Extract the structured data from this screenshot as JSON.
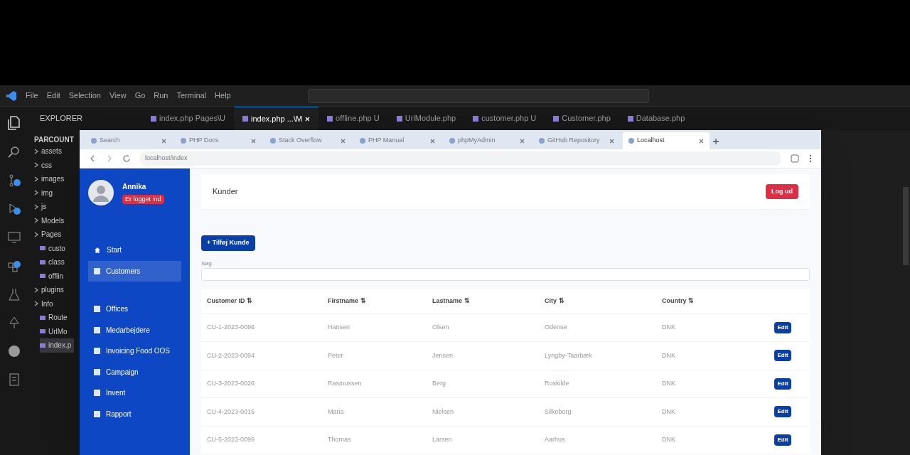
{
  "editor": {
    "menu": [
      "File",
      "Edit",
      "Selection",
      "View",
      "Go",
      "Run",
      "Terminal",
      "Help"
    ],
    "tabs": [
      {
        "label": "index.php Pages\\U",
        "selected": false
      },
      {
        "label": "index.php ...\\M",
        "selected": true
      },
      {
        "label": "offline.php U",
        "selected": false
      },
      {
        "label": "UrlModule.php",
        "selected": false
      },
      {
        "label": "customer.php U",
        "selected": false
      },
      {
        "label": "Customer.php",
        "selected": false
      },
      {
        "label": "Database.php",
        "selected": false
      }
    ],
    "explorer": {
      "title": "EXPLORER",
      "root": "PARCOUNT",
      "items": [
        {
          "label": "assets",
          "kind": "folder"
        },
        {
          "label": "css",
          "kind": "folder"
        },
        {
          "label": "images",
          "kind": "folder"
        },
        {
          "label": "img",
          "kind": "folder"
        },
        {
          "label": "js",
          "kind": "folder"
        },
        {
          "label": "Models",
          "kind": "folder"
        },
        {
          "label": "Pages",
          "kind": "folder"
        },
        {
          "label": "custo",
          "kind": "file"
        },
        {
          "label": "class",
          "kind": "file"
        },
        {
          "label": "offlin",
          "kind": "file"
        },
        {
          "label": "plugins",
          "kind": "folder"
        },
        {
          "label": "Info",
          "kind": "folder"
        },
        {
          "label": "Route",
          "kind": "file"
        },
        {
          "label": "UrlMo",
          "kind": "file"
        },
        {
          "label": "index.p",
          "kind": "file",
          "selected": true
        }
      ]
    }
  },
  "browser": {
    "tabs": [
      {
        "label": "Search",
        "selected": false
      },
      {
        "label": "PHP Docs",
        "selected": false
      },
      {
        "label": "Stack Overflow",
        "selected": false
      },
      {
        "label": "PHP Manual",
        "selected": false
      },
      {
        "label": "phpMyAdmin",
        "selected": false
      },
      {
        "label": "GitHub Repository",
        "selected": false
      },
      {
        "label": "Localhost",
        "selected": true
      }
    ],
    "address": "localhost/index"
  },
  "app": {
    "user": {
      "name": "Annika",
      "status": "Er logget ind"
    },
    "nav": [
      {
        "label": "Start",
        "selected": false
      },
      {
        "label": "Customers",
        "selected": true
      },
      {
        "label": "Offices",
        "selected": false
      },
      {
        "label": "Medarbejdere",
        "selected": false
      },
      {
        "label": "Invoicing Food OOS",
        "selected": false
      },
      {
        "label": "Campaign",
        "selected": false
      },
      {
        "label": "Invent",
        "selected": false
      },
      {
        "label": "Rapport",
        "selected": false
      }
    ],
    "page_title": "Kunder",
    "logout": "Log ud",
    "add_button": "+ Tilføj Kunde",
    "search_label": "Søg:",
    "table": {
      "columns": [
        "Customer ID ⇅",
        "Firstname ⇅",
        "Lastname ⇅",
        "City ⇅",
        "Country ⇅"
      ],
      "rows": [
        [
          "CU-1-2023-0096",
          "Hansen",
          "Olsen",
          "Odense",
          "DNK",
          "Edit"
        ],
        [
          "CU-2-2023-0094",
          "Peter",
          "Jensen",
          "Lyngby-Taarbæk",
          "DNK",
          "Edit"
        ],
        [
          "CU-3-2023-0026",
          "Rasmussen",
          "Berg",
          "Roskilde",
          "DNK",
          "Edit"
        ],
        [
          "CU-4-2023-0015",
          "Maria",
          "Nielsen",
          "Silkeborg",
          "DNK",
          "Edit"
        ],
        [
          "CU-5-2023-0099",
          "Thomas",
          "Larsen",
          "Aarhus",
          "DNK",
          "Edit"
        ]
      ]
    }
  }
}
